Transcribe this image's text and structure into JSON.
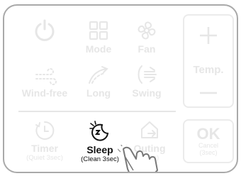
{
  "buttons": {
    "power": {
      "icon": "power-icon"
    },
    "mode": {
      "label": "Mode",
      "icon": "mode-icon"
    },
    "fan": {
      "label": "Fan",
      "icon": "fan-icon"
    },
    "windfree": {
      "label": "Wind-free",
      "icon": "wind-free-icon"
    },
    "long": {
      "label": "Long",
      "icon": "long-icon"
    },
    "swing": {
      "label": "Swing",
      "icon": "swing-icon"
    },
    "timer": {
      "label": "Timer",
      "sub": "(Quiet 3sec)",
      "icon": "timer-icon"
    },
    "sleep": {
      "label": "Sleep",
      "sub": "(Clean 3sec)",
      "icon": "sleep-icon"
    },
    "outing": {
      "label": "Outing",
      "sub": "(3sec)",
      "icon": "outing-icon"
    }
  },
  "temp": {
    "label": "Temp."
  },
  "ok": {
    "label": "OK",
    "sub1": "Cancel",
    "sub2": "(3sec)"
  },
  "colors": {
    "inactive": "#e6e6e6",
    "active": "#111111",
    "border": "#a9a9a9"
  }
}
